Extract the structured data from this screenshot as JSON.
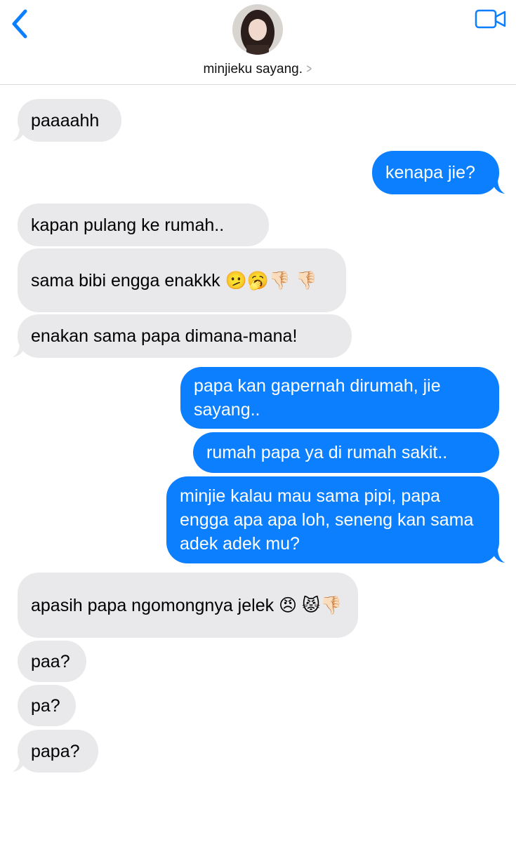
{
  "header": {
    "contact_name": "minjieku sayang.",
    "back_icon": "chevron-left-icon",
    "video_icon": "video-camera-icon",
    "accent_color": "#0b7ffe"
  },
  "messages": [
    {
      "direction": "in",
      "text": "paaaahh"
    },
    {
      "direction": "out",
      "text": "kenapa jie?"
    },
    {
      "direction": "in",
      "text": "kapan pulang ke rumah.."
    },
    {
      "direction": "in",
      "text": "sama bibi engga enakkk 🫤🥱👎🏻 👎🏻"
    },
    {
      "direction": "in",
      "text": "enakan sama papa dimana-mana!"
    },
    {
      "direction": "out",
      "text": "papa kan gapernah dirumah, jie sayang.."
    },
    {
      "direction": "out",
      "text": "rumah papa ya di rumah sakit.."
    },
    {
      "direction": "out",
      "text": "minjie kalau mau sama pipi, papa engga apa apa loh, seneng kan sama adek adek mu?"
    },
    {
      "direction": "in",
      "text": "apasih papa ngomongnya jelek 😠 😾👎🏻"
    },
    {
      "direction": "in",
      "text": "paa?"
    },
    {
      "direction": "in",
      "text": "pa?"
    },
    {
      "direction": "in",
      "text": "papa?"
    }
  ],
  "colors": {
    "incoming_bubble": "#e9e9eb",
    "outgoing_bubble": "#0b7ffe"
  }
}
